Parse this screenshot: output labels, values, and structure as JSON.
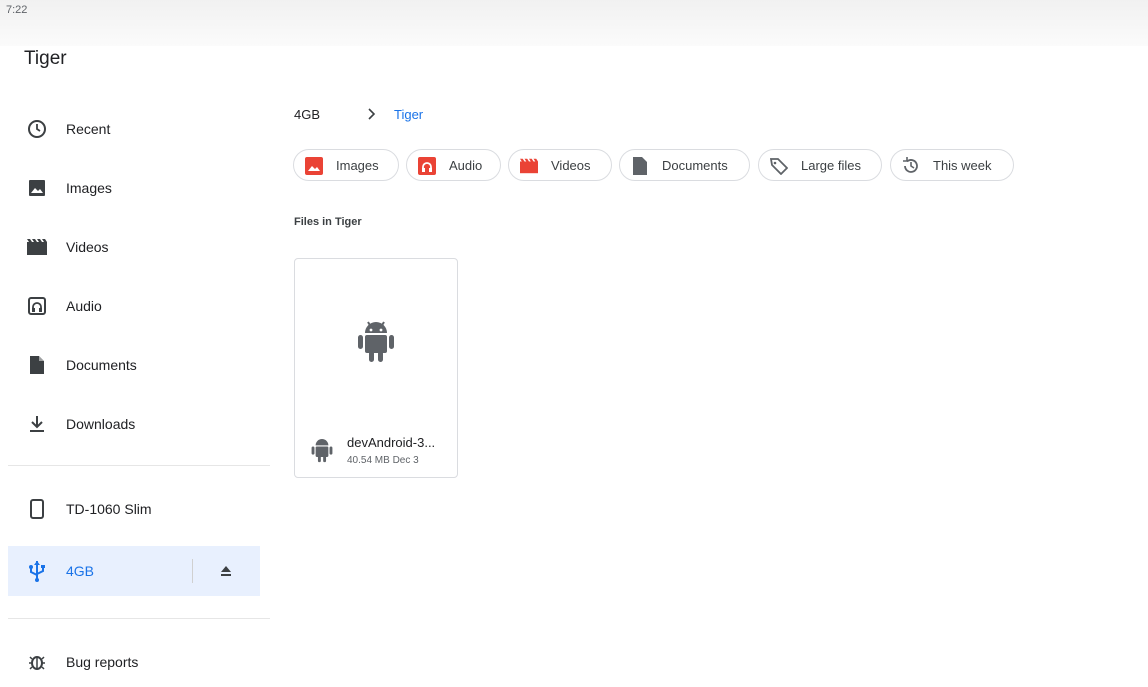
{
  "status_bar": {
    "time": "7:22"
  },
  "app": {
    "title": "Tiger"
  },
  "sidebar": {
    "items": [
      {
        "label": "Recent",
        "icon": "clock-icon"
      },
      {
        "label": "Images",
        "icon": "image-icon"
      },
      {
        "label": "Videos",
        "icon": "movie-icon"
      },
      {
        "label": "Audio",
        "icon": "audio-icon"
      },
      {
        "label": "Documents",
        "icon": "document-icon"
      },
      {
        "label": "Downloads",
        "icon": "download-icon"
      }
    ],
    "devices": [
      {
        "label": "TD-1060 Slim",
        "icon": "phone-icon"
      },
      {
        "label": "4GB",
        "icon": "usb-icon",
        "active": true,
        "eject_icon": "eject-icon"
      }
    ],
    "extra": [
      {
        "label": "Bug reports",
        "icon": "bug-icon"
      }
    ]
  },
  "breadcrumb": {
    "root": "4GB",
    "current": "Tiger"
  },
  "filter_chips": [
    {
      "label": "Images",
      "icon": "image-icon",
      "color": "#ea4335"
    },
    {
      "label": "Audio",
      "icon": "audio-icon",
      "color": "#ea4335"
    },
    {
      "label": "Videos",
      "icon": "movie-icon",
      "color": "#ea4335"
    },
    {
      "label": "Documents",
      "icon": "document-icon",
      "color": "#5f6368"
    },
    {
      "label": "Large files",
      "icon": "label-icon",
      "color": "#5f6368"
    },
    {
      "label": "This week",
      "icon": "history-icon",
      "color": "#5f6368"
    }
  ],
  "files_section": {
    "title": "Files in Tiger"
  },
  "files": [
    {
      "name": "devAndroid-3...",
      "size": "40.54 MB",
      "date": "Dec 3",
      "meta": "40.54 MB Dec 3",
      "icon": "android-icon"
    }
  ],
  "colors": {
    "accent": "#1a73e8",
    "active_bg": "#e8f0fe",
    "chip_red": "#ea4335",
    "icon_gray": "#5f6368"
  }
}
